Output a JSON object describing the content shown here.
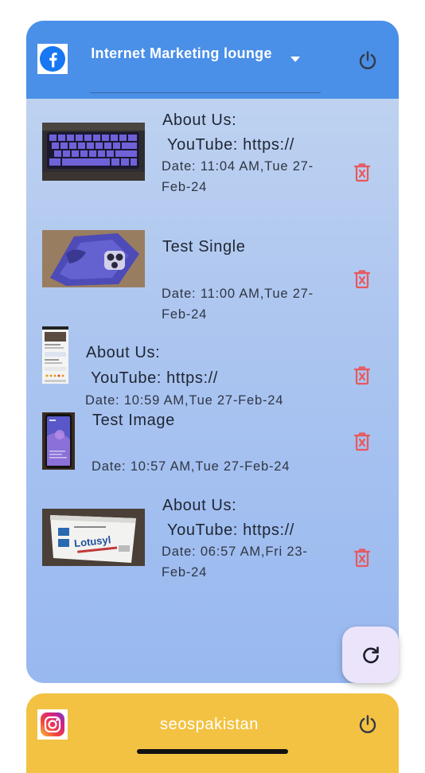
{
  "facebook": {
    "page_name": "Internet Marketing lounge",
    "posts": [
      {
        "title": "About Us:",
        "link": "YouTube: https://",
        "date": "Date: 11:04 AM,Tue 27-Feb-24"
      },
      {
        "title": "Test Single",
        "link": "",
        "date": "Date: 11:00 AM,Tue 27-Feb-24"
      },
      {
        "title": "About Us:",
        "link": "YouTube: https://",
        "date": "Date: 10:59 AM,Tue 27-Feb-24"
      },
      {
        "title": "Test Image",
        "link": "",
        "date": "Date: 10:57 AM,Tue 27-Feb-24"
      },
      {
        "title": "About Us:",
        "link": "YouTube: https://",
        "date": "Date: 06:57 AM,Fri 23-Feb-24"
      }
    ]
  },
  "instagram": {
    "account_name": "seospakistan"
  },
  "icons": {
    "facebook": "facebook-logo-icon",
    "instagram": "instagram-logo-icon",
    "power": "power-icon",
    "delete": "trash-icon",
    "refresh": "refresh-icon",
    "dropdown": "chevron-down-icon"
  },
  "colors": {
    "header_blue": "#4a8fe8",
    "instagram_yellow": "#f3c242",
    "delete_red": "#e8585c"
  }
}
